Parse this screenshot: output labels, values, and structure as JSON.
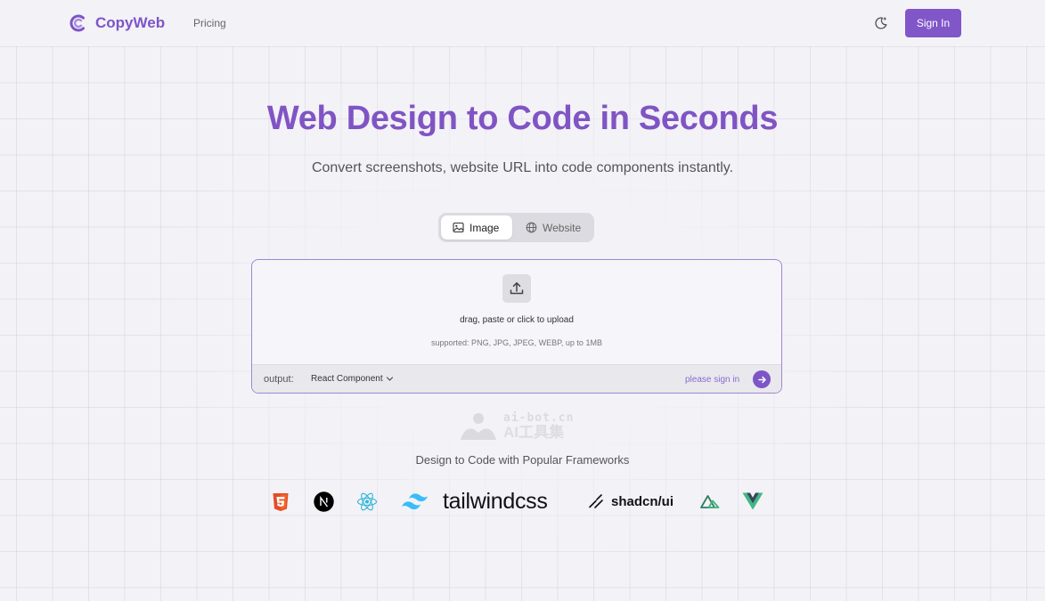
{
  "header": {
    "brand": "CopyWeb",
    "nav_pricing": "Pricing",
    "signin_label": "Sign In"
  },
  "hero": {
    "title": "Web Design to Code in Seconds",
    "subtitle": "Convert screenshots, website URL into code components instantly."
  },
  "mode_toggle": {
    "image_label": "Image",
    "website_label": "Website",
    "active": "Image"
  },
  "upload": {
    "prompt": "drag, paste or click to upload",
    "supported": "supported: PNG, JPG, JPEG, WEBP, up to 1MB",
    "output_label": "output:",
    "output_value": "React Component",
    "signin_hint": "please sign in"
  },
  "watermark": {
    "top": "ai-bot.cn",
    "bottom": "AI工具集"
  },
  "frameworks": {
    "label": "Design to Code with Popular Frameworks",
    "tailwind": "tailwindcss",
    "shadcn": "shadcn/ui",
    "items": [
      "html5-icon",
      "nextjs-icon",
      "react-icon",
      "tailwindcss-logo",
      "shadcn-logo",
      "nuxt-icon",
      "vue-icon"
    ]
  },
  "colors": {
    "brand": "#8156c9",
    "background": "#f3f2f7"
  }
}
